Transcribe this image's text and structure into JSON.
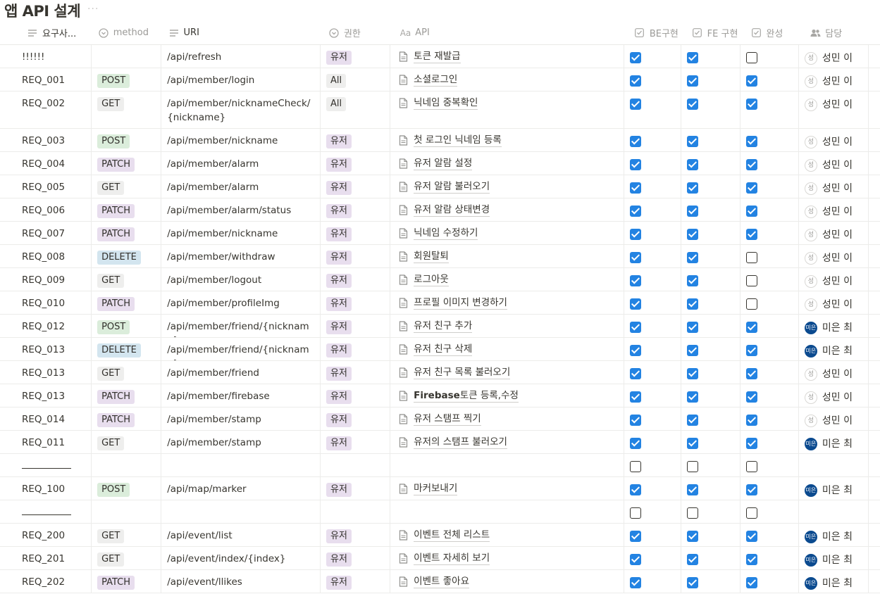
{
  "page": {
    "title": "앱 API 설계",
    "more": "···"
  },
  "columns": {
    "req": "요구사...",
    "method": "method",
    "uri": "URI",
    "perm": "권한",
    "api": "API",
    "be": "BE구현",
    "fe": "FE 구현",
    "done": "완성",
    "owner": "담당"
  },
  "rows": [
    {
      "req": "!!!!!!",
      "method": "",
      "uri": "/api/refresh",
      "perm": "유저",
      "api": "토큰 재발급",
      "be": true,
      "fe": true,
      "done": false,
      "owner": "성민 이",
      "avatar": "성",
      "h": 33
    },
    {
      "req": "REQ_001",
      "method": "POST",
      "uri": "/api/member/login",
      "perm": "All",
      "api": "소셜로그인",
      "be": true,
      "fe": true,
      "done": true,
      "owner": "성민 이",
      "avatar": "성",
      "h": 33
    },
    {
      "req": "REQ_002",
      "method": "GET",
      "uri": "/api/member/nicknameCheck/{nickname}",
      "perm": "All",
      "api": "닉네임 중복확인",
      "be": true,
      "fe": true,
      "done": true,
      "owner": "성민 이",
      "avatar": "성",
      "h": 53
    },
    {
      "req": "REQ_003",
      "method": "POST",
      "uri": "/api/member/nickname",
      "perm": "유저",
      "api": "첫 로그인 닉네임 등록",
      "be": true,
      "fe": true,
      "done": true,
      "owner": "성민 이",
      "avatar": "성",
      "h": 33
    },
    {
      "req": "REQ_004",
      "method": "PATCH",
      "uri": "/api/member/alarm",
      "perm": "유저",
      "api": "유저 알람 설정",
      "be": true,
      "fe": true,
      "done": true,
      "owner": "성민 이",
      "avatar": "성",
      "h": 33
    },
    {
      "req": "REQ_005",
      "method": "GET",
      "uri": "/api/member/alarm",
      "perm": "유저",
      "api": "유저 알람 불러오기",
      "be": true,
      "fe": true,
      "done": true,
      "owner": "성민 이",
      "avatar": "성",
      "h": 33
    },
    {
      "req": "REQ_006",
      "method": "PATCH",
      "uri": "/api/member/alarm/status",
      "perm": "유저",
      "api": "유저 알람 상태변경",
      "be": true,
      "fe": true,
      "done": true,
      "owner": "성민 이",
      "avatar": "성",
      "h": 33
    },
    {
      "req": "REQ_007",
      "method": "PATCH",
      "uri": "/api/member/nickname",
      "perm": "유저",
      "api": "닉네임 수정하기",
      "be": true,
      "fe": true,
      "done": true,
      "owner": "성민 이",
      "avatar": "성",
      "h": 33
    },
    {
      "req": "REQ_008",
      "method": "DELETE",
      "uri": "/api/member/withdraw",
      "perm": "유저",
      "api": "회원탈퇴",
      "be": true,
      "fe": true,
      "done": false,
      "owner": "성민 이",
      "avatar": "성",
      "h": 33
    },
    {
      "req": "REQ_009",
      "method": "GET",
      "uri": "/api/member/logout",
      "perm": "유저",
      "api": "로그아웃",
      "be": true,
      "fe": true,
      "done": false,
      "owner": "성민 이",
      "avatar": "성",
      "h": 33
    },
    {
      "req": "REQ_010",
      "method": "PATCH",
      "uri": "/api/member/profileImg",
      "perm": "유저",
      "api": "프로필 이미지 변경하기",
      "be": true,
      "fe": true,
      "done": false,
      "owner": "성민 이",
      "avatar": "성",
      "h": 33
    },
    {
      "req": "REQ_012",
      "method": "POST",
      "uri": "/api/member/friend/{nickname}",
      "perm": "유저",
      "api": "유저 친구 추가",
      "be": true,
      "fe": true,
      "done": true,
      "owner": "미은 최",
      "avatar": "미은",
      "h": 33
    },
    {
      "req": "REQ_013",
      "method": "DELETE",
      "uri": "/api/member/friend/{nickname}",
      "perm": "유저",
      "api": "유저 친구 삭제",
      "be": true,
      "fe": true,
      "done": true,
      "owner": "미은 최",
      "avatar": "미은",
      "h": 33
    },
    {
      "req": "REQ_013",
      "method": "GET",
      "uri": "/api/member/friend",
      "perm": "유저",
      "api": "유저 친구 목록 불러오기",
      "be": true,
      "fe": true,
      "done": true,
      "owner": "성민 이",
      "avatar": "성",
      "h": 33
    },
    {
      "req": "REQ_013",
      "method": "PATCH",
      "uri": "/api/member/firebase",
      "perm": "유저",
      "api_bold": "Firebase",
      "api": "토큰 등록,수정",
      "be": true,
      "fe": true,
      "done": true,
      "owner": "성민 이",
      "avatar": "성",
      "h": 33
    },
    {
      "req": "REQ_014",
      "method": "PATCH",
      "uri": "/api/member/stamp",
      "perm": "유저",
      "api": "유저 스탬프 찍기",
      "be": true,
      "fe": true,
      "done": true,
      "owner": "성민 이",
      "avatar": "성",
      "h": 33
    },
    {
      "req": "REQ_011",
      "method": "GET",
      "uri": "/api/member/stamp",
      "perm": "유저",
      "api": "유저의 스탬프 불러오기",
      "be": true,
      "fe": true,
      "done": true,
      "owner": "미은 최",
      "avatar": "미은",
      "h": 33
    },
    {
      "separator": true,
      "be": false,
      "fe": false,
      "done": false,
      "h": 33
    },
    {
      "req": "REQ_100",
      "method": "POST",
      "uri": "/api/map/marker",
      "perm": "유저",
      "api": "마커보내기",
      "be": true,
      "fe": true,
      "done": true,
      "owner": "미은 최",
      "avatar": "미은",
      "h": 33
    },
    {
      "separator": true,
      "be": false,
      "fe": false,
      "done": false,
      "h": 33
    },
    {
      "req": "REQ_200",
      "method": "GET",
      "uri": "/api/event/list",
      "perm": "유저",
      "api": "이벤트 전체 리스트",
      "be": true,
      "fe": true,
      "done": true,
      "owner": "미은 최",
      "avatar": "미은",
      "h": 33
    },
    {
      "req": "REQ_201",
      "method": "GET",
      "uri": "/api/event/index/{index}",
      "perm": "유저",
      "api": "이벤트 자세히 보기",
      "be": true,
      "fe": true,
      "done": true,
      "owner": "미은 최",
      "avatar": "미은",
      "h": 33
    },
    {
      "req": "REQ_202",
      "method": "PATCH",
      "uri": "/api/event/llikes",
      "perm": "유저",
      "api": "이벤트 좋아요",
      "be": true,
      "fe": true,
      "done": true,
      "owner": "미은 최",
      "avatar": "미은",
      "h": 33
    }
  ],
  "colors": {
    "checkbox_on": "#2383e2",
    "tag_post": "#dbeddb",
    "tag_get": "#eeeeed",
    "tag_patch": "#e8deee",
    "tag_delete": "#d3e5ef",
    "avatar_dark": "#0b4a8f"
  }
}
